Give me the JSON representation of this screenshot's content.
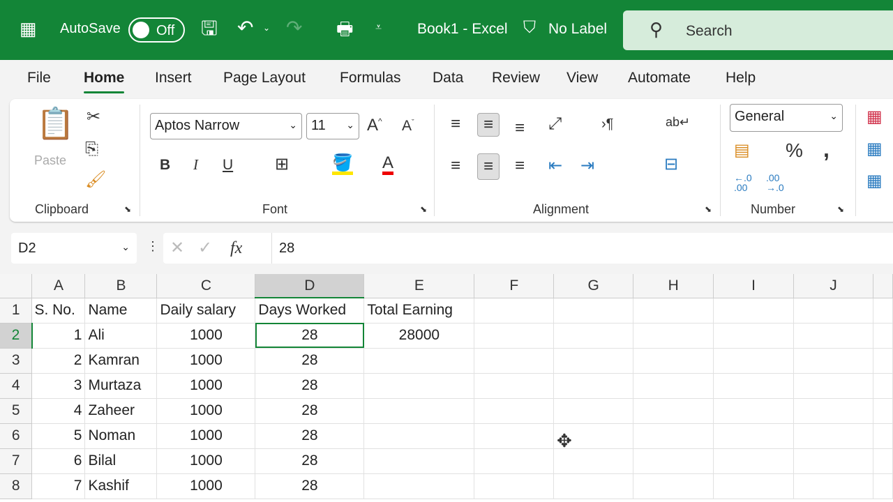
{
  "titlebar": {
    "autosave_label": "AutoSave",
    "toggle_state": "Off",
    "doc_title": "Book1  -  Excel",
    "label": "No Label",
    "search_placeholder": "Search"
  },
  "tabs": [
    "File",
    "Home",
    "Insert",
    "Page Layout",
    "Formulas",
    "Data",
    "Review",
    "View",
    "Automate",
    "Help"
  ],
  "ribbon": {
    "paste": "Paste",
    "clipboard": "Clipboard",
    "font_name": "Aptos Narrow",
    "font_size": "11",
    "font": "Font",
    "alignment": "Alignment",
    "number_format": "General",
    "number": "Number",
    "bold": "B",
    "italic": "I",
    "underline": "U"
  },
  "formula_bar": {
    "name_box": "D2",
    "fx": "fx",
    "value": "28"
  },
  "grid": {
    "columns": [
      "A",
      "B",
      "C",
      "D",
      "E",
      "F",
      "G",
      "H",
      "I",
      "J"
    ],
    "rows": [
      {
        "n": "1",
        "cells": [
          "S. No.",
          "Name",
          "Daily salary",
          "Days Worked",
          "Total Earning"
        ]
      },
      {
        "n": "2",
        "cells": [
          "1",
          "Ali",
          "1000",
          "28",
          "28000"
        ]
      },
      {
        "n": "3",
        "cells": [
          "2",
          "Kamran",
          "1000",
          "28",
          ""
        ]
      },
      {
        "n": "4",
        "cells": [
          "3",
          "Murtaza",
          "1000",
          "28",
          ""
        ]
      },
      {
        "n": "5",
        "cells": [
          "4",
          "Zaheer",
          "1000",
          "28",
          ""
        ]
      },
      {
        "n": "6",
        "cells": [
          "5",
          "Noman",
          "1000",
          "28",
          ""
        ]
      },
      {
        "n": "7",
        "cells": [
          "6",
          "Bilal",
          "1000",
          "28",
          ""
        ]
      },
      {
        "n": "8",
        "cells": [
          "7",
          "Kashif",
          "1000",
          "28",
          ""
        ]
      }
    ],
    "active_cell": "D2"
  }
}
